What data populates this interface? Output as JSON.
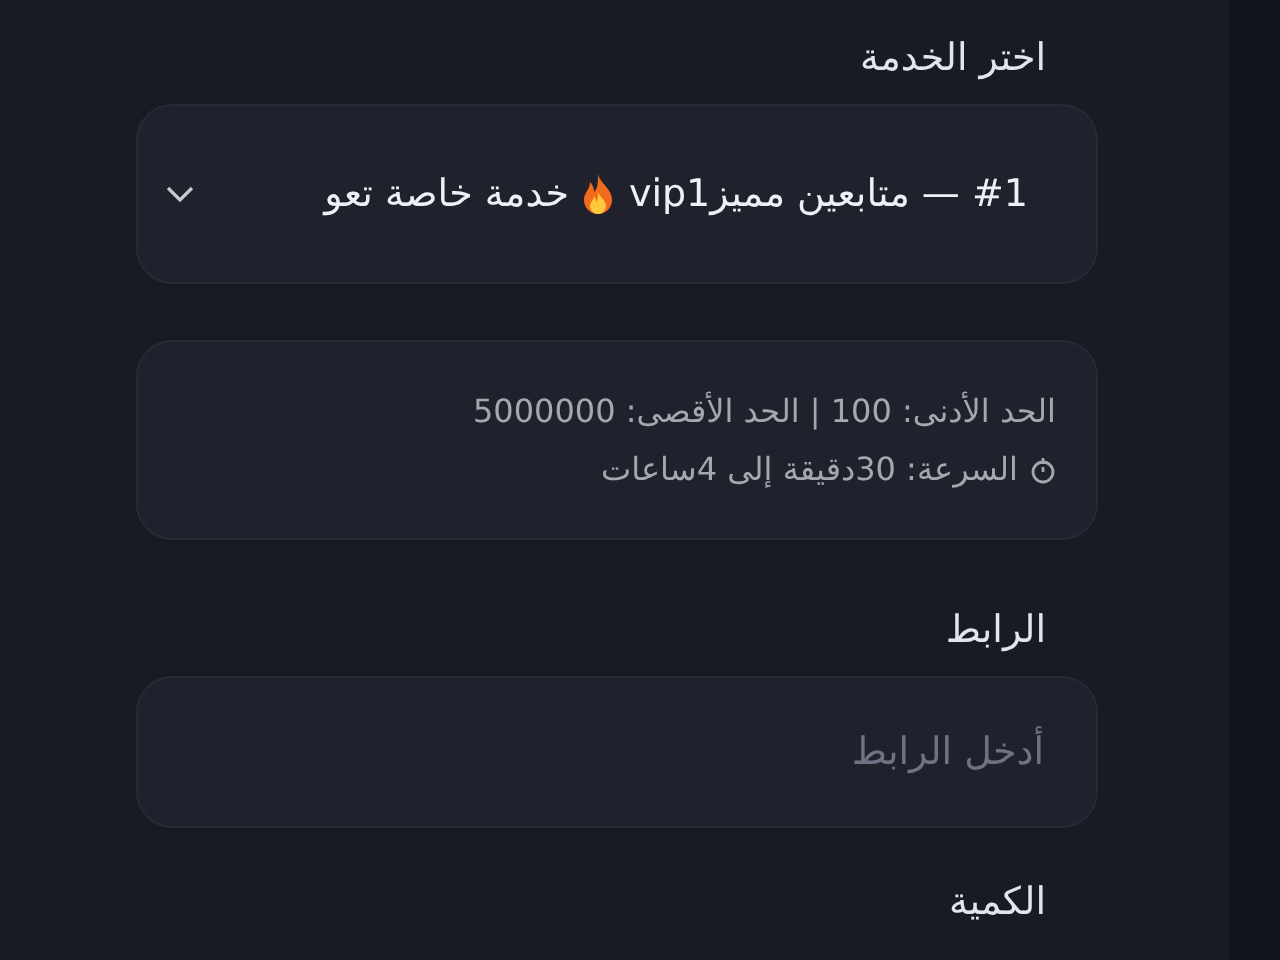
{
  "service": {
    "label": "اختر الخدمة",
    "value_start": "#1 — متابعين مميزvip1",
    "value_end": "خدمة خاصة تعو"
  },
  "info": {
    "limits": "الحد الأدنى: 100 | الحد الأقصى: 5000000",
    "speed": "السرعة: 30دقيقة إلى 4ساعات"
  },
  "link": {
    "label": "الرابط",
    "placeholder": "أدخل الرابط"
  },
  "quantity": {
    "label": "الكمية"
  }
}
